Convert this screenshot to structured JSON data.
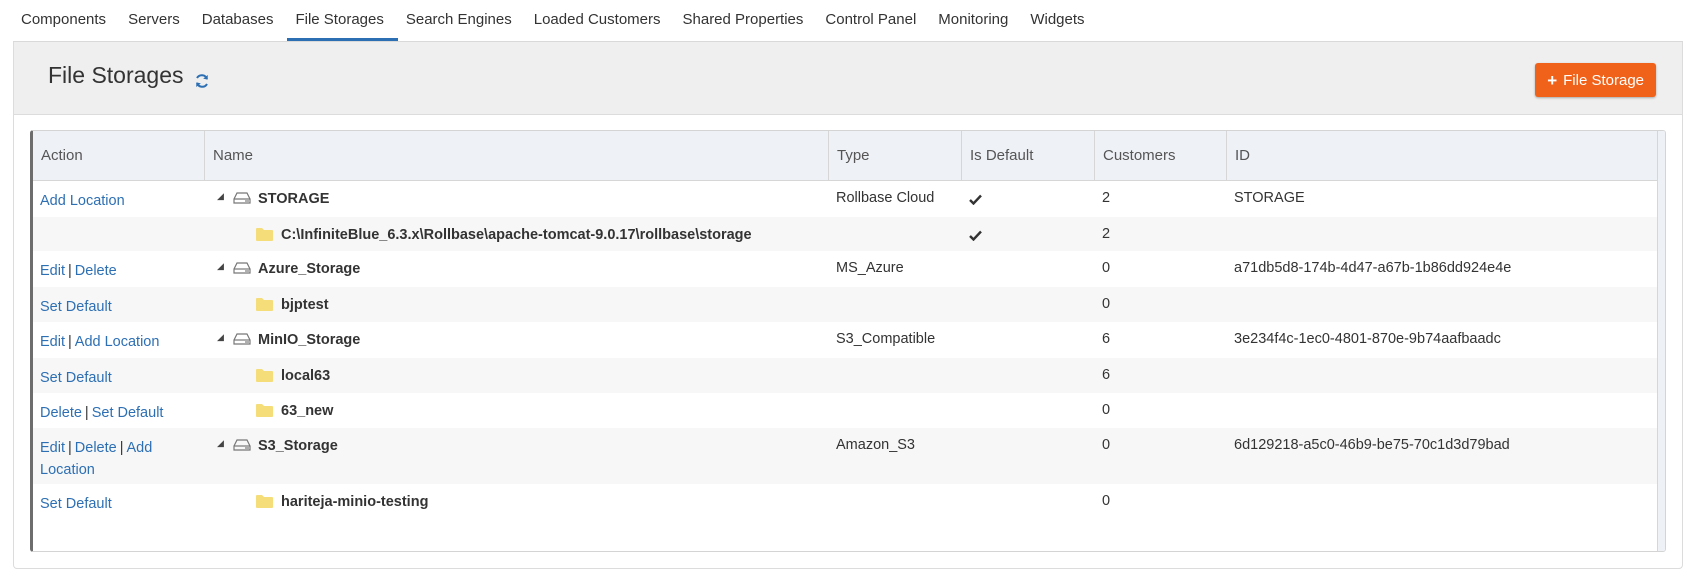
{
  "tabs": [
    {
      "label": "Components",
      "active": false
    },
    {
      "label": "Servers",
      "active": false
    },
    {
      "label": "Databases",
      "active": false
    },
    {
      "label": "File Storages",
      "active": true
    },
    {
      "label": "Search Engines",
      "active": false
    },
    {
      "label": "Loaded Customers",
      "active": false
    },
    {
      "label": "Shared Properties",
      "active": false
    },
    {
      "label": "Control Panel",
      "active": false
    },
    {
      "label": "Monitoring",
      "active": false
    },
    {
      "label": "Widgets",
      "active": false
    }
  ],
  "page": {
    "title": "File Storages",
    "add_button_label": "File Storage",
    "accent_color": "#f0621a",
    "link_color": "#2d6fb3",
    "icons": {
      "refresh": "refresh-icon",
      "add": "plus-icon",
      "drive": "drive-icon",
      "folder": "folder-icon",
      "check": "check-icon",
      "expand": "collapse-triangle-icon"
    }
  },
  "table": {
    "columns": [
      "Action",
      "Name",
      "Type",
      "Is Default",
      "Customers",
      "ID"
    ],
    "rows": [
      {
        "level": "storage",
        "actions": [
          "Add Location"
        ],
        "name": "STORAGE",
        "type": "Rollbase Cloud",
        "is_default": true,
        "customers": "2",
        "id": "STORAGE"
      },
      {
        "level": "location",
        "actions": [],
        "name": "C:\\InfiniteBlue_6.3.x\\Rollbase\\apache-tomcat-9.0.17\\rollbase\\storage",
        "type": "",
        "is_default": true,
        "customers": "2",
        "id": ""
      },
      {
        "level": "storage",
        "actions": [
          "Edit",
          "Delete"
        ],
        "name": "Azure_Storage",
        "type": "MS_Azure",
        "is_default": false,
        "customers": "0",
        "id": "a71db5d8-174b-4d47-a67b-1b86dd924e4e"
      },
      {
        "level": "location",
        "actions": [
          "Set Default"
        ],
        "name": "bjptest",
        "type": "",
        "is_default": false,
        "customers": "0",
        "id": ""
      },
      {
        "level": "storage",
        "actions": [
          "Edit",
          "Add Location"
        ],
        "name": "MinIO_Storage",
        "type": "S3_Compatible",
        "is_default": false,
        "customers": "6",
        "id": "3e234f4c-1ec0-4801-870e-9b74aafbaadc"
      },
      {
        "level": "location",
        "actions": [
          "Set Default"
        ],
        "name": "local63",
        "type": "",
        "is_default": false,
        "customers": "6",
        "id": ""
      },
      {
        "level": "location",
        "actions": [
          "Delete",
          "Set Default"
        ],
        "name": "63_new",
        "type": "",
        "is_default": false,
        "customers": "0",
        "id": ""
      },
      {
        "level": "storage",
        "actions": [
          "Edit",
          "Delete",
          "Add Location"
        ],
        "name": "S3_Storage",
        "type": "Amazon_S3",
        "is_default": false,
        "customers": "0",
        "id": "6d129218-a5c0-46b9-be75-70c1d3d79bad"
      },
      {
        "level": "location",
        "actions": [
          "Set Default"
        ],
        "name": "hariteja-minio-testing",
        "type": "",
        "is_default": false,
        "customers": "0",
        "id": ""
      }
    ]
  }
}
